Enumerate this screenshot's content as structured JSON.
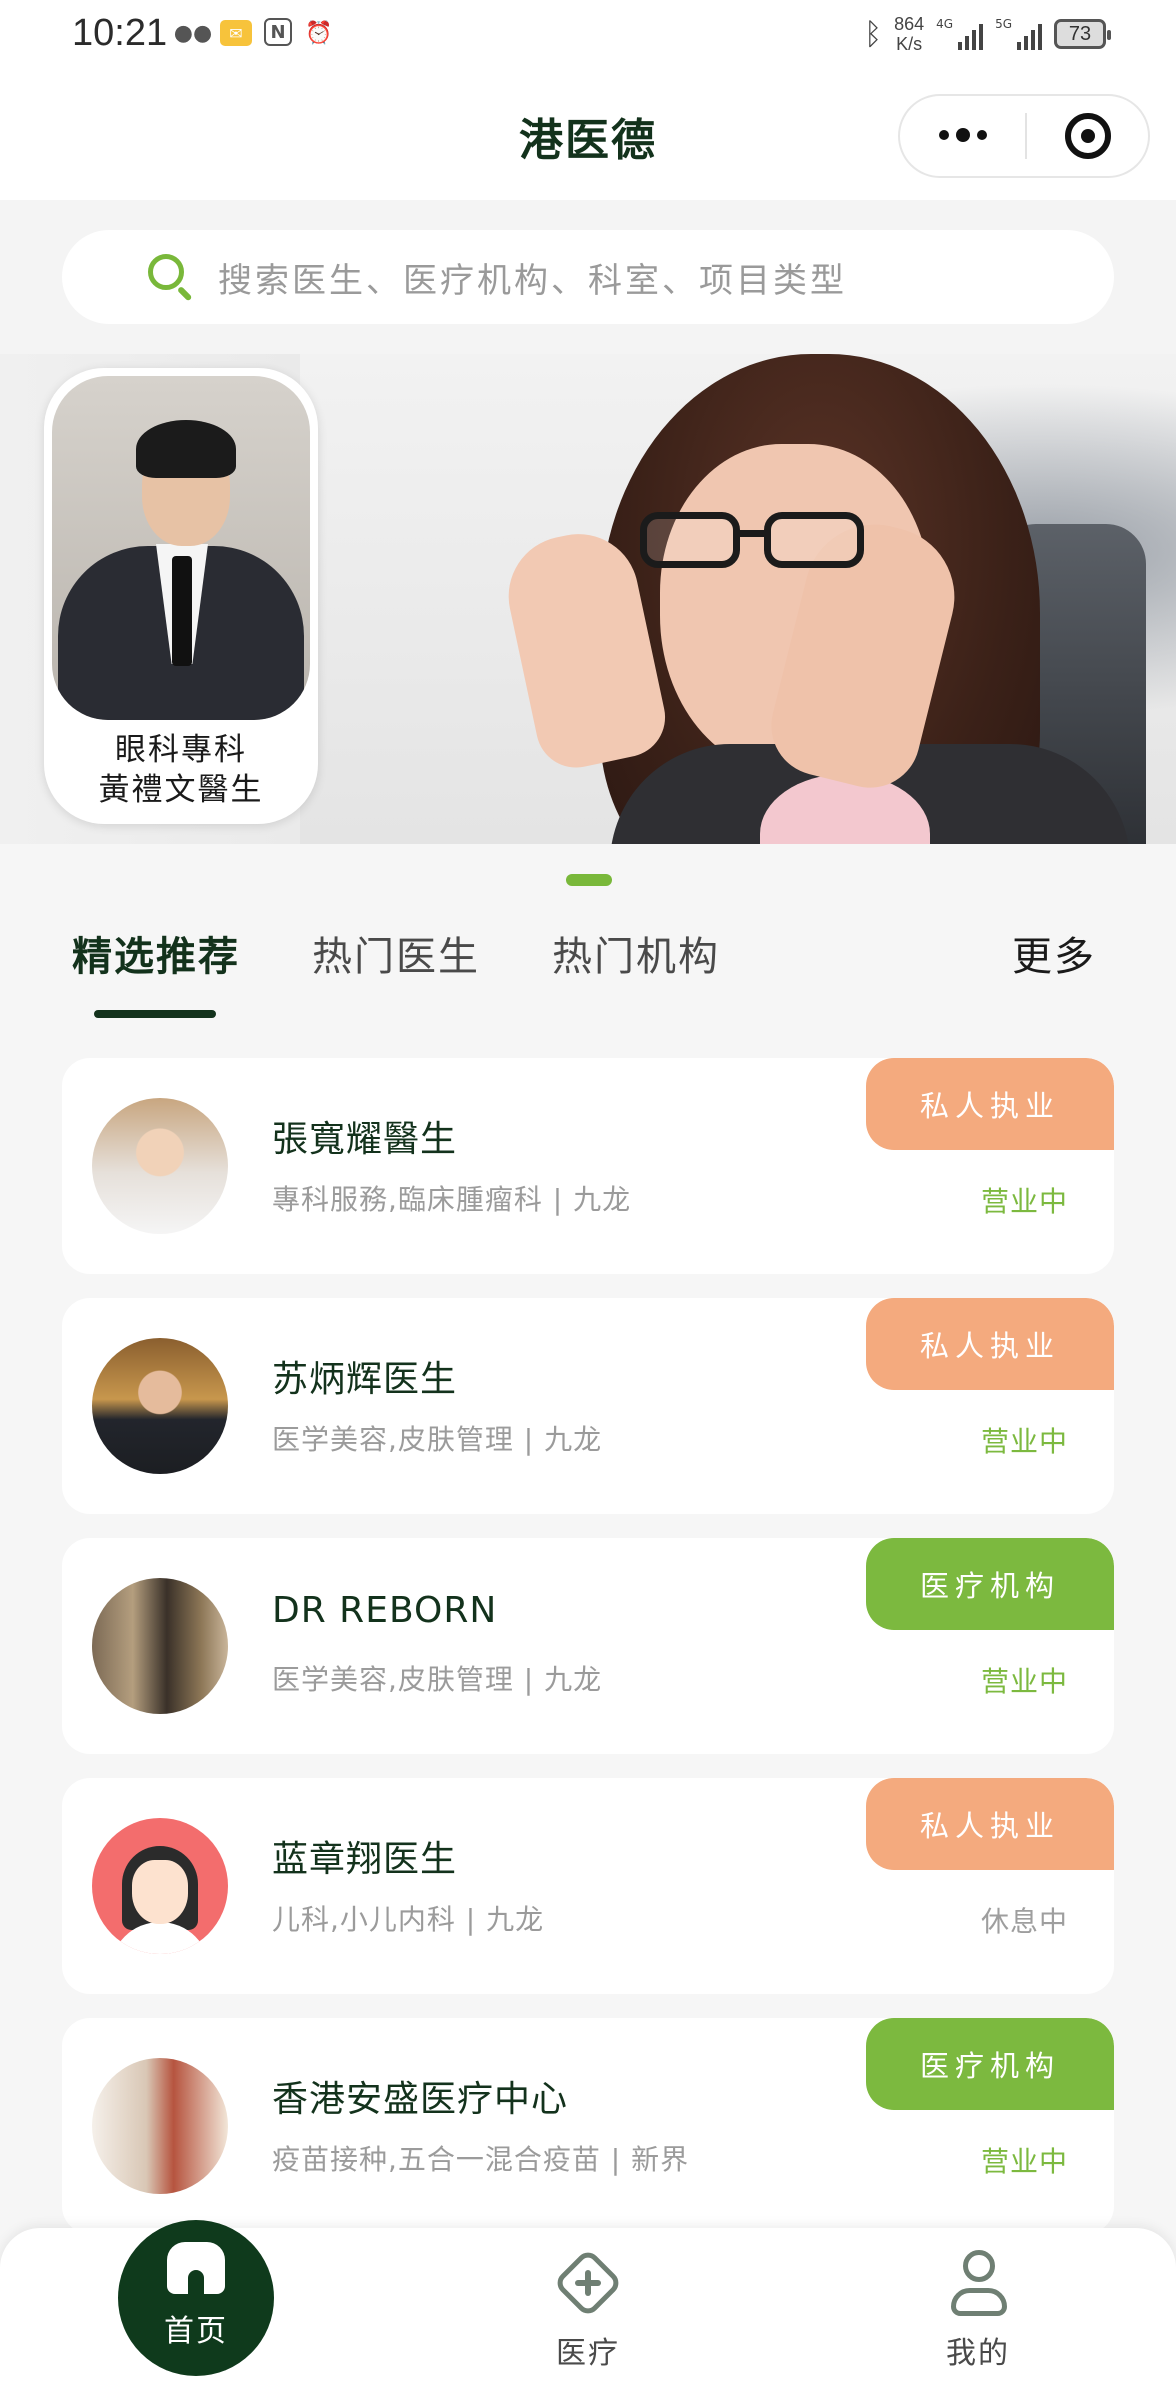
{
  "status_bar": {
    "time": "10:21",
    "net_speed_value": "864",
    "net_speed_unit": "K/s",
    "signal_label_1": "4G",
    "signal_label_2": "5G",
    "battery": "73"
  },
  "nav": {
    "title": "港医德"
  },
  "search": {
    "placeholder": "搜索医生、医疗机构、科室、项目类型"
  },
  "banner": {
    "caption_line1": "眼科專科",
    "caption_line2": "黃禮文醫生"
  },
  "tabs": [
    {
      "label": "精选推荐",
      "active": true
    },
    {
      "label": "热门医生",
      "active": false
    },
    {
      "label": "热门机构",
      "active": false
    }
  ],
  "more_label": "更多",
  "list": [
    {
      "title": "張寬耀醫生",
      "subtitle": "專科服務,臨床腫瘤科 | 九龙",
      "badge": "私人执业",
      "badge_color": "#f4aa7e",
      "status": "营业中"
    },
    {
      "title": "苏炳辉医生",
      "subtitle": "医学美容,皮肤管理 | 九龙",
      "badge": "私人执业",
      "badge_color": "#f4aa7e",
      "status": "营业中"
    },
    {
      "title": "DR REBORN",
      "subtitle": "医学美容,皮肤管理 | 九龙",
      "badge": "医疗机构",
      "badge_color": "#7cb93f",
      "status": "营业中"
    },
    {
      "title": "蓝章翔医生",
      "subtitle": "儿科,小儿内科 | 九龙",
      "badge": "私人执业",
      "badge_color": "#f4aa7e",
      "status": "休息中"
    },
    {
      "title": "香港安盛医疗中心",
      "subtitle": "疫苗接种,五合一混合疫苗 | 新界",
      "badge": "医疗机构",
      "badge_color": "#7cb93f",
      "status": "营业中"
    }
  ],
  "tabbar": [
    {
      "label": "首页",
      "icon": "home-icon",
      "active": true
    },
    {
      "label": "医疗",
      "icon": "medical-cross-icon",
      "active": false
    },
    {
      "label": "我的",
      "icon": "profile-icon",
      "active": false
    }
  ],
  "colors": {
    "brand_dark_green": "#13321c",
    "accent_green": "#7cb93f",
    "accent_orange": "#f4aa7e"
  }
}
